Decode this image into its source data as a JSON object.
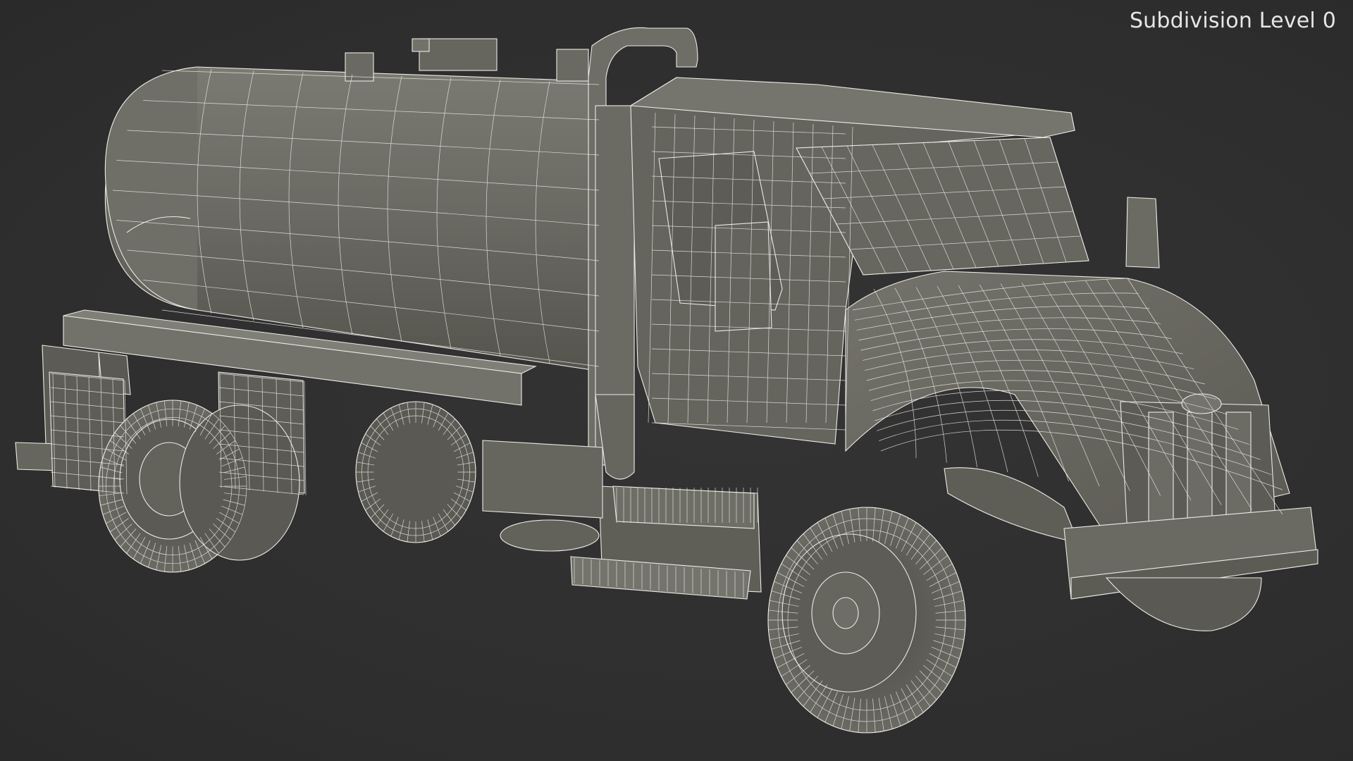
{
  "viewport": {
    "overlay_label": "Subdivision Level 0",
    "background_color": "#2f2f2f",
    "render_mode": "wireframe-on-shaded"
  },
  "model": {
    "subject": "vacuum tank truck",
    "shading": {
      "body_color": "#6d6c65",
      "body_dark": "#55544e",
      "body_light": "#7e7d75",
      "wire_color": "#eeeeea"
    }
  }
}
